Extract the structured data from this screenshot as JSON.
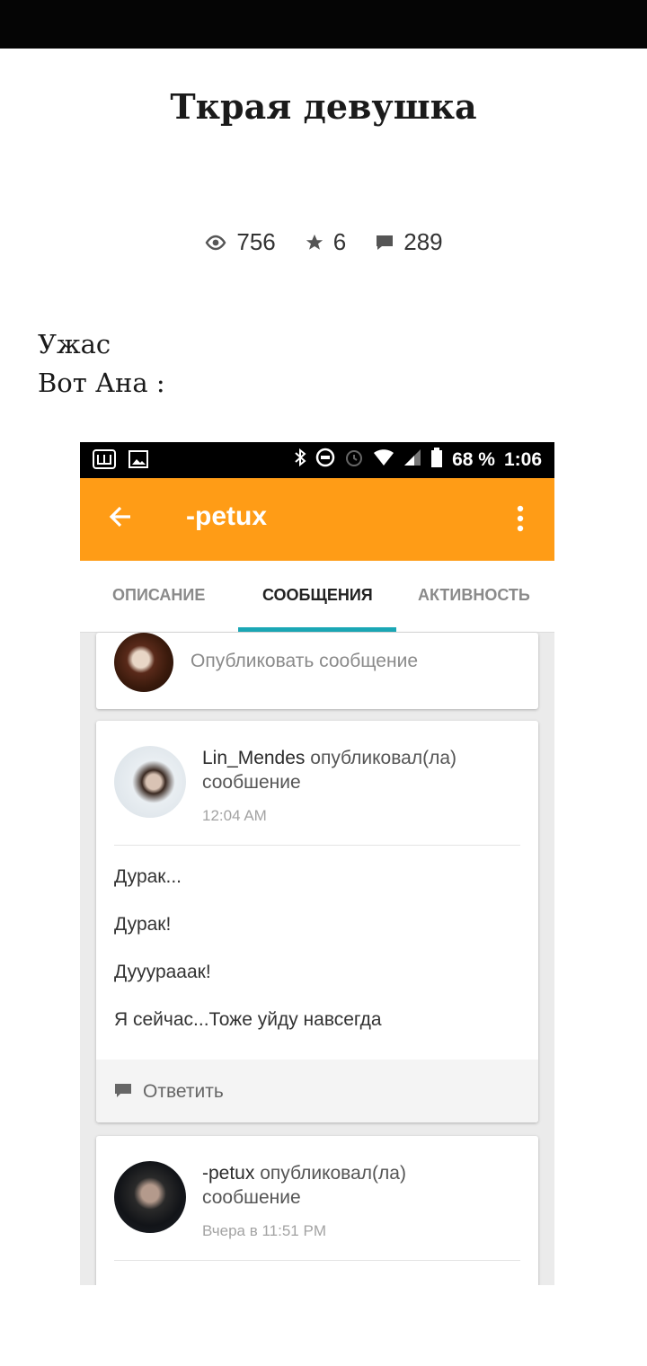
{
  "title": "Ткрая девушка",
  "stats": {
    "views": "756",
    "stars": "6",
    "comments": "289"
  },
  "body": {
    "line1": "Ужас",
    "line2": "Вот Ана :"
  },
  "screenshot": {
    "status": {
      "battery": "68 %",
      "time": "1:06"
    },
    "appbar": {
      "title": "-petux"
    },
    "tabs": [
      {
        "label": "ОПИСАНИЕ"
      },
      {
        "label": "СООБЩЕНИЯ",
        "active": true
      },
      {
        "label": "АКТИВНОСТЬ"
      }
    ],
    "compose_placeholder": "Опубликовать сообщение",
    "posts": [
      {
        "author": "Lin_Mendes",
        "action": "опубликовал(ла) сообшение",
        "time": "12:04 AM",
        "lines": [
          "Дурак...",
          "Дурак!",
          "Дууурааак!",
          "Я сейчас...Тоже уйду навсегда"
        ],
        "reply_label": "Ответить"
      },
      {
        "author": "-petux",
        "action": "опубликовал(ла) сообшение",
        "time": "Вчера в 11:51 PM"
      }
    ],
    "accent_color": "#ff9c16",
    "tab_indicator_color": "#1aa7b5"
  }
}
